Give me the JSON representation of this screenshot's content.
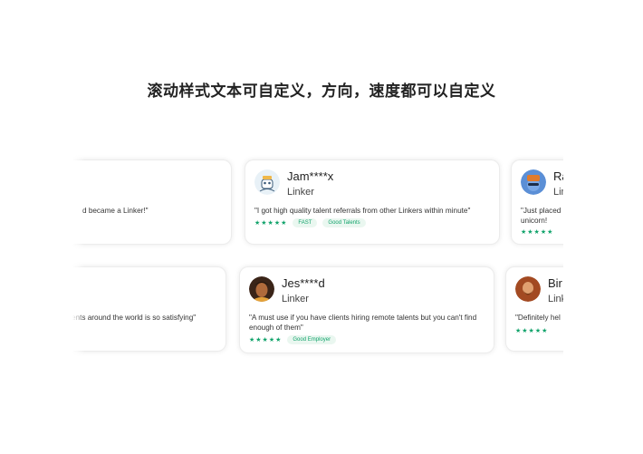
{
  "title": "滚动样式文本可自定义，方向，速度都可以自定义",
  "colors": {
    "accent": "#11a36b",
    "tag_bg": "#eaf7f0"
  },
  "stars": "★★★★★",
  "row1": {
    "cards": [
      {
        "quote": "d became a Linker!\""
      },
      {
        "avatar": "robot-avatar",
        "name": "Jam****x",
        "role": "Linker",
        "quote": "\"I got high quality talent referrals from other Linkers within minute\"",
        "tags": [
          "FAST",
          "Good Talents"
        ]
      },
      {
        "avatar": "hat-avatar",
        "name": "Ra",
        "role": "Lin",
        "quote_line1": "\"Just placed",
        "quote_line2": "unicorn!"
      }
    ]
  },
  "row2": {
    "cards": [
      {
        "quote": "ents around the world is so satisfying\""
      },
      {
        "avatar": "woman-avatar",
        "name": "Jes****d",
        "role": "Linker",
        "quote": "\"A must use if you have clients hiring remote talents but you can't find enough of them\"",
        "tags": [
          "Good Employer"
        ]
      },
      {
        "avatar": "bearded-avatar",
        "name": "Bir",
        "role": "Link",
        "quote": "\"Definitely hel"
      }
    ]
  }
}
